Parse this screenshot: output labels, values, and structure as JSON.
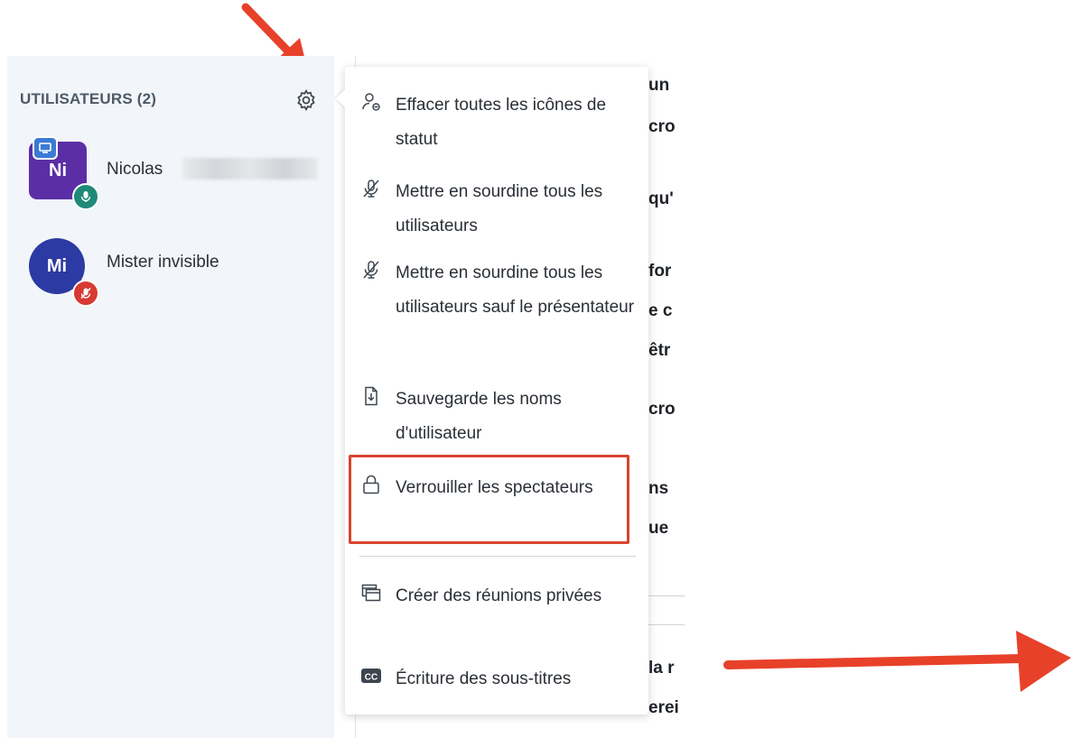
{
  "users_panel": {
    "title": "UTILISATEURS (2)",
    "users": [
      {
        "initials": "Ni",
        "name": "Nicolas",
        "name_obscured": true,
        "avatar_color": "#5b2ea6",
        "status": "microphone-on",
        "role": "presenter"
      },
      {
        "initials": "Mi",
        "name": "Mister invisible",
        "avatar_color": "#2c3aa3",
        "status": "microphone-muted"
      }
    ]
  },
  "menu": {
    "items": [
      {
        "label": "Effacer toutes les icônes de statut",
        "icon": "clear-status-icon"
      },
      {
        "label": "Mettre en sourdine tous les utilisateurs",
        "icon": "mute-icon"
      },
      {
        "label": "Mettre en sourdine tous les utilisateurs sauf le présentateur",
        "icon": "mute-icon"
      },
      {
        "label": "Sauvegarde les noms d'utilisateur",
        "icon": "download-file-icon"
      },
      {
        "label": "Verrouiller les spectateurs",
        "icon": "lock-icon",
        "highlighted": true
      },
      {
        "label": "Créer des réunions privées",
        "icon": "breakout-rooms-icon"
      },
      {
        "label": "Écriture des sous-titres",
        "icon": "closed-captions-icon"
      }
    ]
  },
  "content_fragments": [
    "un",
    "cro",
    "qu'",
    "for",
    "e c",
    "êtr",
    "cro",
    "ns",
    "ue",
    "la r",
    "erei"
  ],
  "colors": {
    "highlight": "#d9442f",
    "arrow": "#e8412a",
    "panel_bg": "#f2f5f9",
    "mic_on": "#1f8a78",
    "muted": "#d63a33",
    "presenter": "#3a7bd5"
  }
}
